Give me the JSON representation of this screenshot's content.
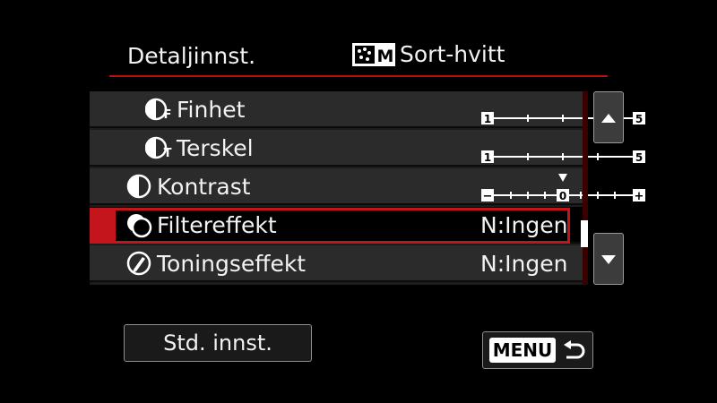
{
  "header": {
    "title": "Detaljinnst.",
    "picture_style": "Sort-hvitt",
    "picture_style_icon": "monochrome-picture-style-icon",
    "icon_letter": "M"
  },
  "rows": [
    {
      "label": "Finhet",
      "icon": "fineness-icon",
      "type": "scale",
      "scale_min": "1",
      "scale_max": "5",
      "level": 4,
      "of": 5
    },
    {
      "label": "Terskel",
      "icon": "threshold-icon",
      "type": "scale",
      "scale_min": "1",
      "scale_max": "5",
      "level": 4,
      "of": 5
    },
    {
      "label": "Kontrast",
      "icon": "contrast-icon",
      "type": "scale",
      "scale_min": "−",
      "scale_center": "0",
      "scale_max": "+",
      "level": 0,
      "range": [
        -4,
        4
      ]
    },
    {
      "label": "Filtereffekt",
      "icon": "filter-effect-icon",
      "type": "value",
      "value": "N:Ingen",
      "selected": true
    },
    {
      "label": "Toningseffekt",
      "icon": "toning-effect-icon",
      "type": "value",
      "value": "N:Ingen"
    }
  ],
  "scroll": {
    "position": 0.67
  },
  "buttons": {
    "default": "Std. innst.",
    "menu": "MENU"
  },
  "colors": {
    "accent": "#c4151c",
    "row_bg": "#2b2b2b",
    "button_bg": "#3c3c3c"
  }
}
